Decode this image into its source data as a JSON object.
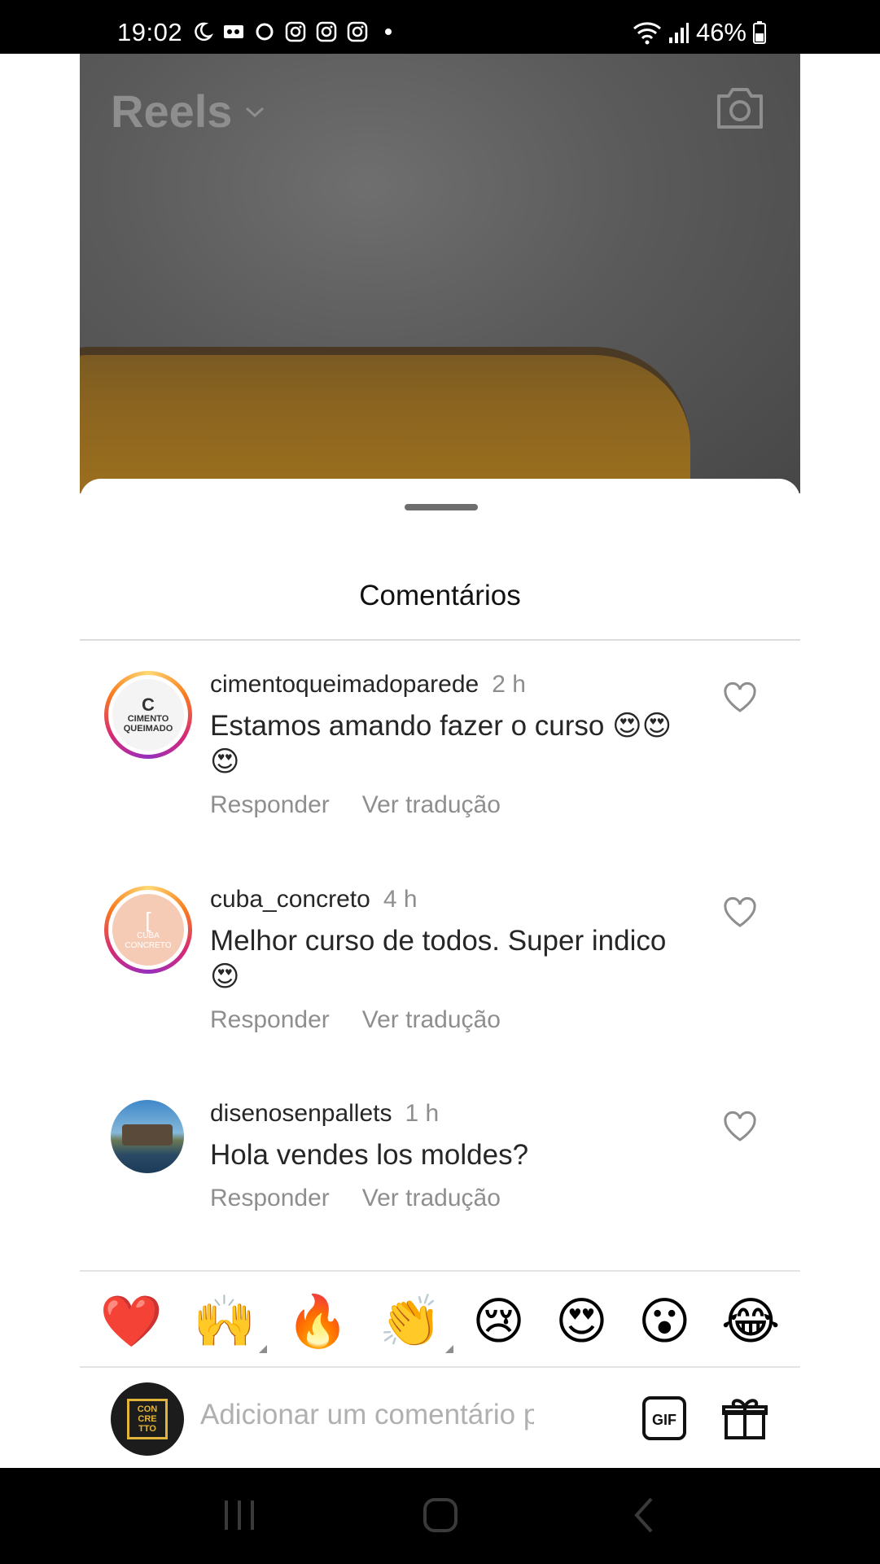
{
  "status_bar": {
    "time": "19:02",
    "battery": "46%"
  },
  "header": {
    "title": "Reels"
  },
  "sheet": {
    "title": "Comentários"
  },
  "comments": [
    {
      "user": "cimentoqueimadoparede",
      "time": "2 h",
      "text": "Estamos amando fazer o curso 😍😍😍",
      "reply": "Responder",
      "translate": "Ver tradução",
      "avatar_text": [
        "C",
        "CIMENTO",
        "QUEIMADO"
      ]
    },
    {
      "user": "cuba_concreto",
      "time": "4 h",
      "text": "Melhor curso de todos. Super indico 😍",
      "reply": "Responder",
      "translate": "Ver tradução",
      "avatar_text": [
        "[",
        "CUBA",
        "CONCRETO"
      ]
    },
    {
      "user": "disenosenpallets",
      "time": "1 h",
      "text": "Hola vendes los moldes?",
      "reply": "Responder",
      "translate": "Ver tradução"
    }
  ],
  "quick_reactions": [
    "❤️",
    "🙌",
    "🔥",
    "👏",
    "😢",
    "😍",
    "😮",
    "😂"
  ],
  "composer": {
    "placeholder": "Adicionar um comentário pa",
    "avatar_text": [
      "CON",
      "CRE",
      "TTO"
    ],
    "gif_label": "GIF"
  }
}
